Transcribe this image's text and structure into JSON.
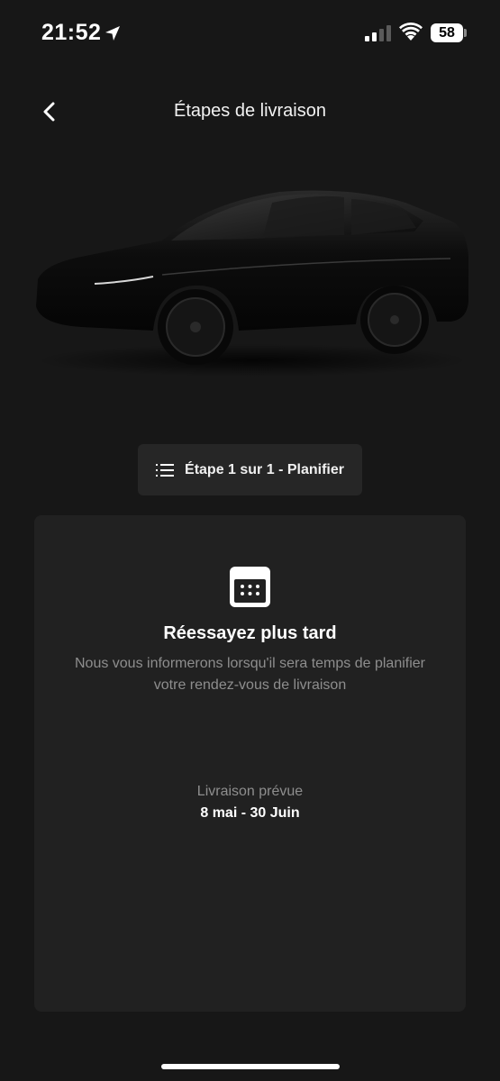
{
  "status_bar": {
    "time": "21:52",
    "battery": "58",
    "icons": [
      "location-arrow-icon",
      "signal-icon",
      "wifi-icon",
      "battery-icon"
    ]
  },
  "header": {
    "back_icon": "chevron-left-icon",
    "title": "Étapes de livraison"
  },
  "step_selector": {
    "icon": "list-icon",
    "label": "Étape 1 sur 1 - Planifier"
  },
  "card": {
    "icon": "calendar-icon",
    "title": "Réessayez plus tard",
    "message": "Nous vous informerons lorsqu'il sera temps de planifier votre rendez-vous de livraison",
    "delivery_label": "Livraison prévue",
    "delivery_dates": "8 mai - 30 Juin"
  },
  "colors": {
    "background": "#171717",
    "card": "#212121",
    "pill": "#262626",
    "muted_text": "#8e8e8e",
    "text": "#ffffff"
  }
}
